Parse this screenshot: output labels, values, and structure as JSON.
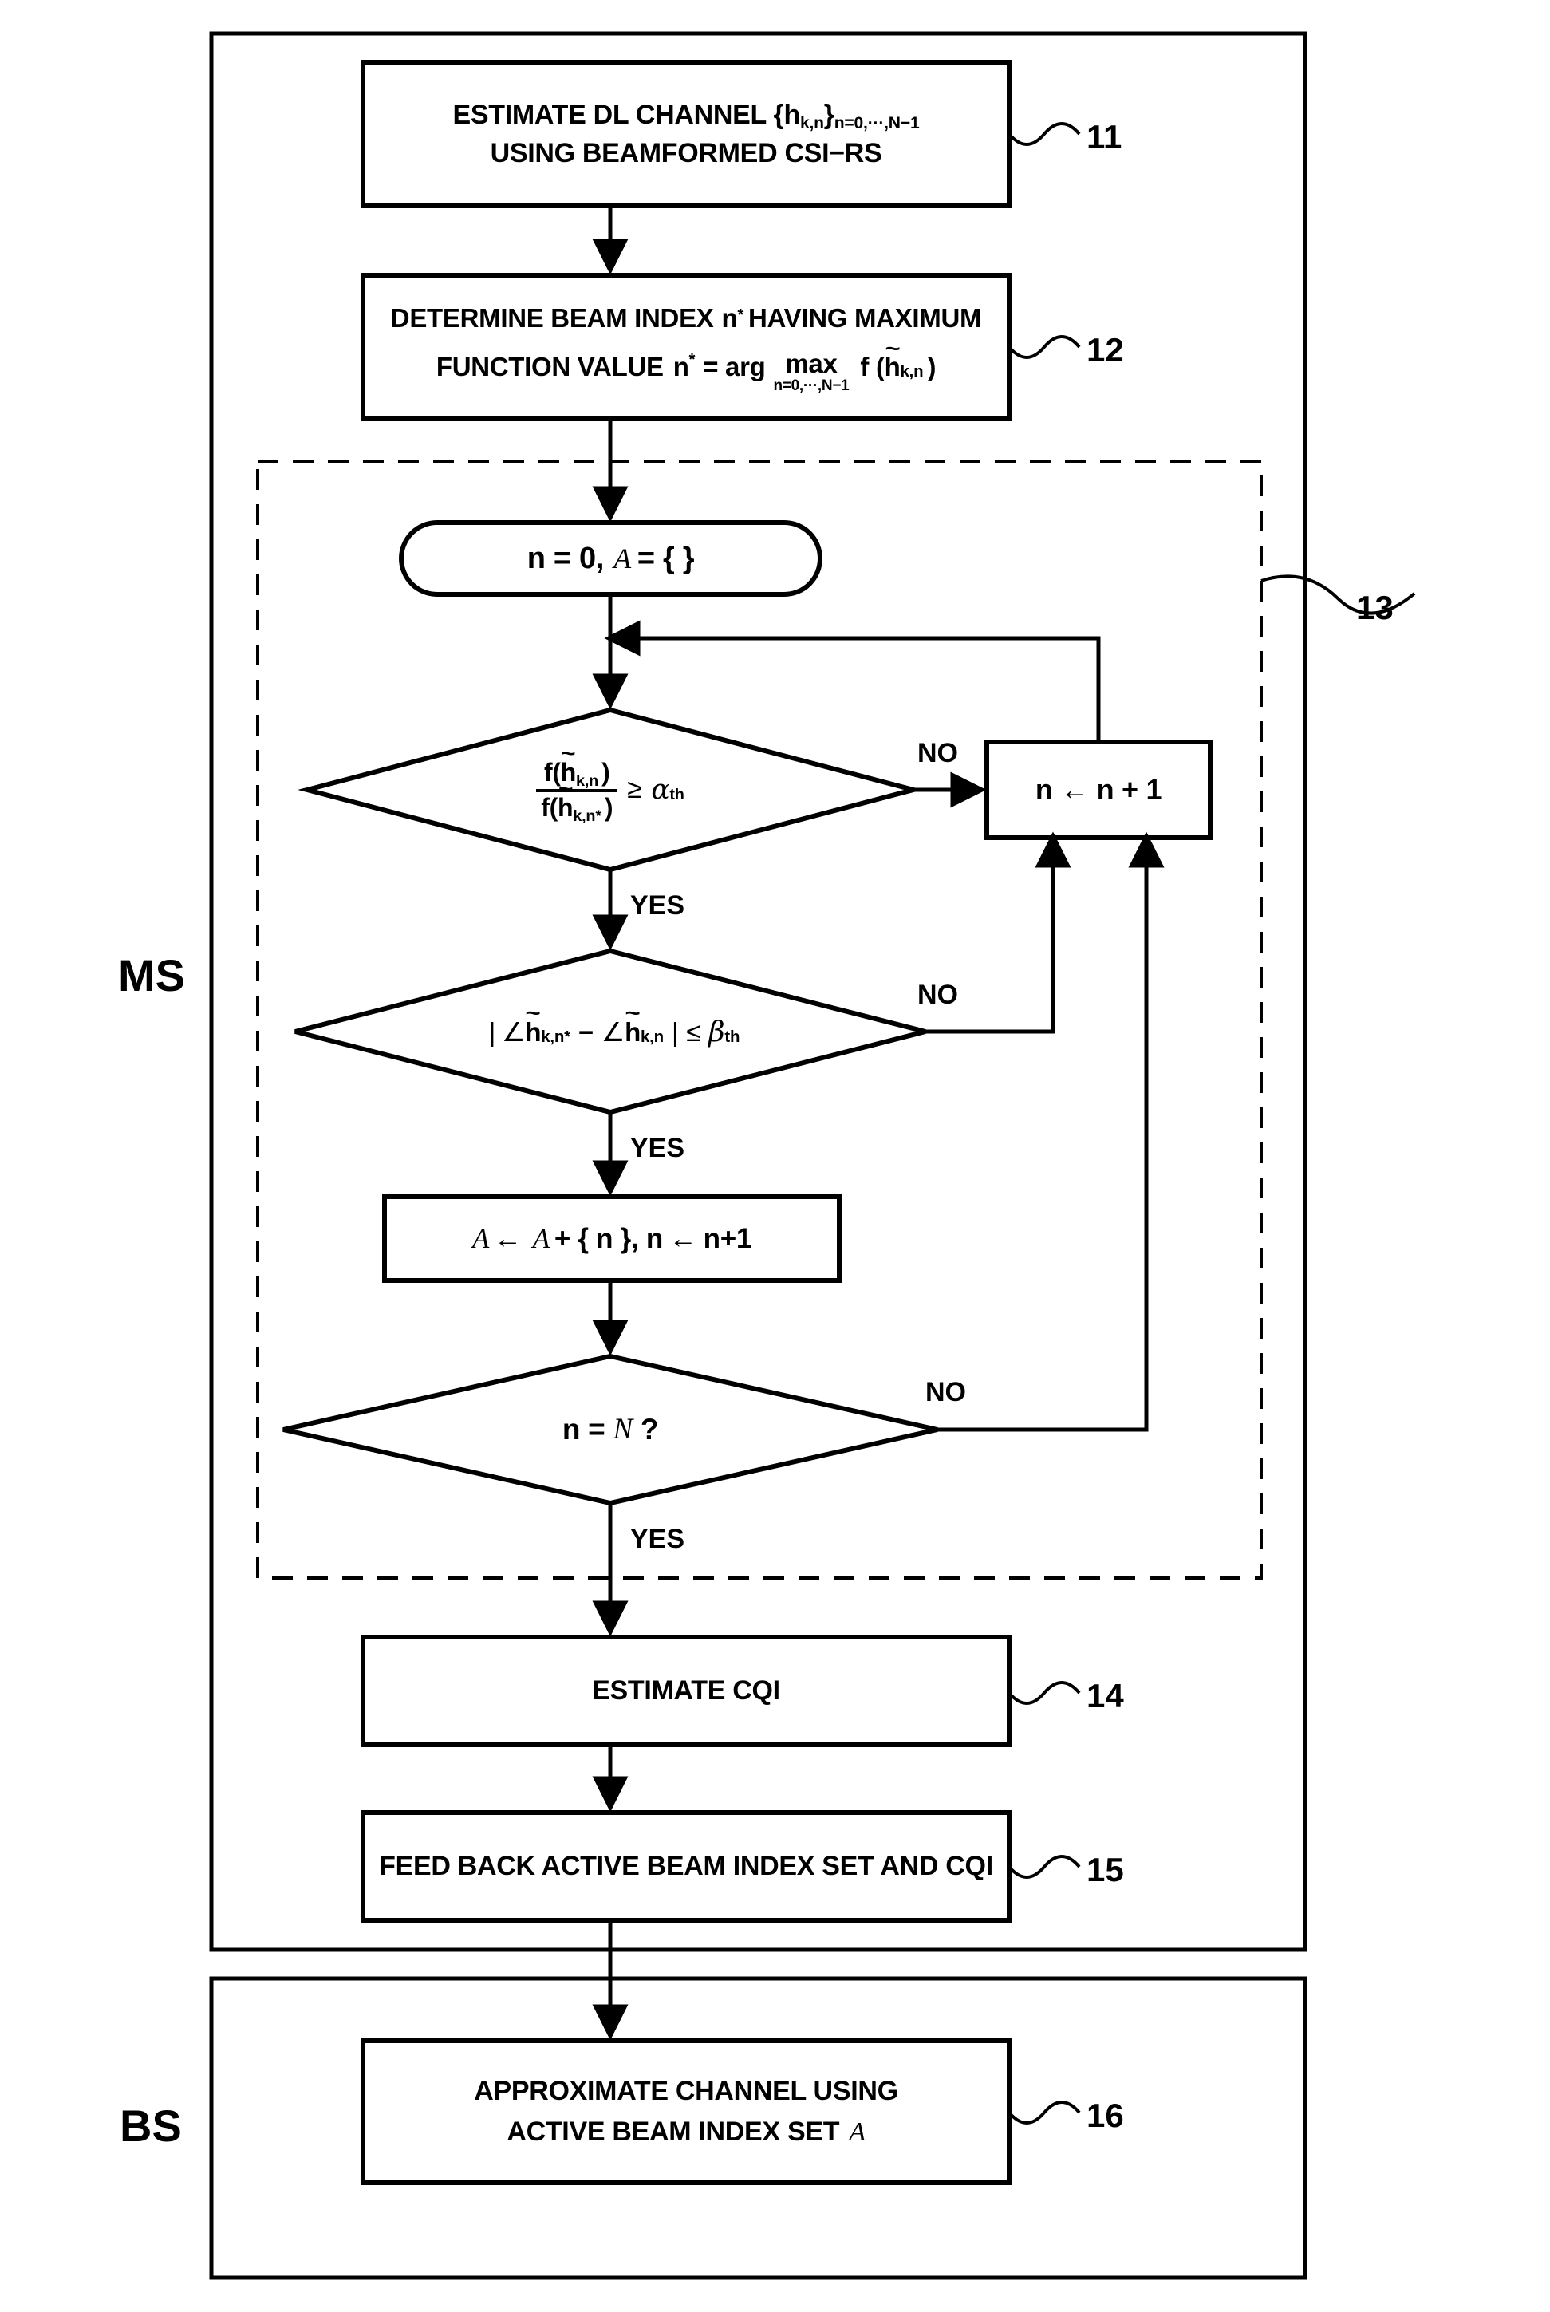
{
  "figure": {
    "title": "Beam selection flowchart",
    "domains": [
      {
        "id": "ms",
        "label": "MS"
      },
      {
        "id": "bs",
        "label": "BS"
      }
    ]
  },
  "reference_numerals": {
    "n11": "11",
    "n12": "12",
    "n13": "13",
    "n14": "14",
    "n15": "15",
    "n16": "16"
  },
  "branch_labels": {
    "no1": "NO",
    "yes1": "YES",
    "no2": "NO",
    "yes2": "YES",
    "no3": "NO",
    "yes3": "YES"
  },
  "nodes": {
    "step11": {
      "line1_a": "ESTIMATE DL CHANNEL {h",
      "line1_sub": "k,n",
      "line1_b": "}",
      "line1_sub2": "n=0,···,N−1",
      "line2": "USING BEAMFORMED CSI−RS",
      "plain": "ESTIMATE DL CHANNEL {h k,n } n=0,...,N-1 USING BEAMFORMED CSI-RS"
    },
    "step12": {
      "line1_a": "DETERMINE BEAM INDEX",
      "line1_var": "n",
      "line1_sup": "*",
      "line1_b": "HAVING MAXIMUM",
      "line2_a": "FUNCTION VALUE",
      "line2_var": "n",
      "line2_sup": "*",
      "line2_eq": "= arg",
      "line2_max": "max",
      "line2_under": "n=0,···,N−1",
      "line2_f": "f (",
      "line2_h": "h",
      "line2_hsub": "k,n",
      "line2_close": ")",
      "plain": "DETERMINE BEAM INDEX n* HAVING MAXIMUM FUNCTION VALUE n* = arg max n=0,...,N-1 f(h~k,n)"
    },
    "start": {
      "a": "n = 0,",
      "setvar": "A",
      "b": "= {  }",
      "plain": "n = 0, A = { }"
    },
    "decision1": {
      "num_f": "f(",
      "num_h": "h",
      "num_sub": "k,n",
      "num_close": ")",
      "den_f": "f(",
      "den_h": "h",
      "den_sub": "k,n*",
      "den_close": ")",
      "rel": "≥",
      "threshold_sym": "α",
      "threshold_sub": "th",
      "plain": "f(h~k,n) / f(h~k,n*) >= alpha_th"
    },
    "increment": {
      "text": "n ← n + 1",
      "plain": "n <- n + 1"
    },
    "decision2": {
      "open": "|",
      "ang1": "∠",
      "h1": "h",
      "h1sub": "k,n*",
      "minus": "−",
      "ang2": "∠",
      "h2": "h",
      "h2sub": "k,n",
      "close": "|",
      "rel": "≤",
      "threshold_sym": "β",
      "threshold_sub": "th",
      "plain": "| <h~k,n* - <h~k,n | <= beta_th"
    },
    "update": {
      "setvar1": "A",
      "arrow1": "←",
      "setvar2": "A",
      "plus": "+ { n }, n",
      "arrow2": "←",
      "tail": "n+1",
      "plain": "A <- A + { n }, n <- n+1"
    },
    "decision3": {
      "a": "n =",
      "bigN": "N",
      "q": "?",
      "plain": "n = N ?"
    },
    "step14": {
      "line1": "ESTIMATE CQI",
      "plain": "ESTIMATE CQI"
    },
    "step15": {
      "line1": "FEED BACK ACTIVE BEAM INDEX SET AND CQI",
      "plain": "FEED BACK ACTIVE BEAM INDEX SET AND CQI"
    },
    "step16": {
      "line1": "APPROXIMATE CHANNEL USING",
      "line2_a": "ACTIVE BEAM INDEX SET",
      "line2_var": "A",
      "plain": "APPROXIMATE CHANNEL USING ACTIVE BEAM INDEX SET A"
    }
  },
  "colors": {
    "stroke": "#000000",
    "background": "#ffffff"
  }
}
